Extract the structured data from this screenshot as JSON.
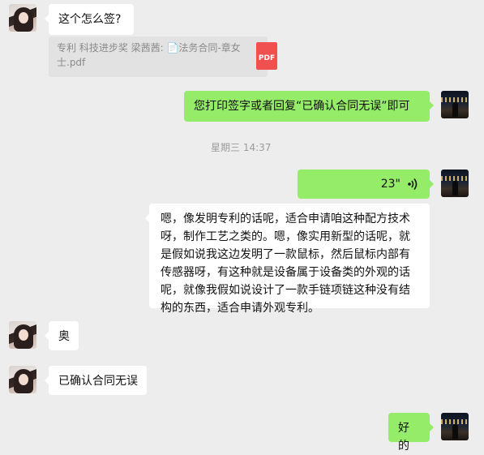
{
  "messages": {
    "m1": {
      "text": "这个怎么签?"
    },
    "quote": {
      "line1": "专利 科技进步奖   梁茜茜: 📄法务合同-章女",
      "line2": "士.pdf",
      "pdf_label": "PDF"
    },
    "m2": {
      "text": "您打印签字或者回复“已确认合同无误”即可"
    },
    "timestamp": "星期三 14:37",
    "voice": {
      "duration": "23\"",
      "icon": "voice-wave-icon"
    },
    "m3": {
      "text": "嗯，像发明专利的话呢，适合申请咱这种配方技术呀，制作工艺之类的。嗯，像实用新型的话呢，就是假如说我这边发明了一款鼠标，然后鼠标内部有传感器呀，有这种就是设备属于设备类的外观的话呢，就像我假如说设计了一款手链项链这种没有结构的东西，适合申请外观专利。"
    },
    "m4": {
      "text": "奥"
    },
    "m5": {
      "text": "已确认合同无误"
    },
    "m6": {
      "text": "好的"
    }
  },
  "colors": {
    "background": "#ededed",
    "sent_bubble": "#95ec69",
    "received_bubble": "#ffffff",
    "pdf": "#f05050"
  }
}
